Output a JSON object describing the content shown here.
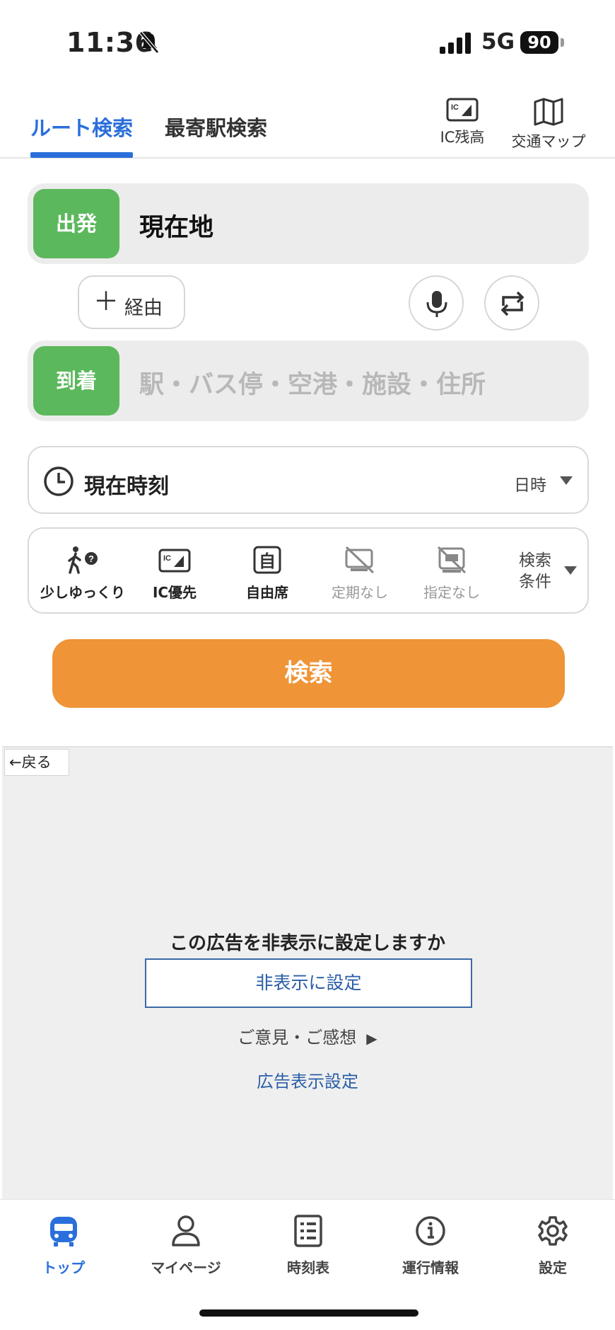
{
  "status_bar": {
    "time": "11:36",
    "network": "5G",
    "battery": "90"
  },
  "header": {
    "tabs": [
      {
        "label": "ルート検索",
        "active": true
      },
      {
        "label": "最寄駅検索",
        "active": false
      }
    ],
    "ic_balance_label": "IC残高",
    "transit_map_label": "交通マップ",
    "accent_color": "#2a6fdb"
  },
  "route": {
    "departure_tag": "出発",
    "departure_value": "現在地",
    "via_label": "経由",
    "arrival_tag": "到着",
    "arrival_placeholder": "駅・バス停・空港・施設・住所",
    "tag_color": "#5cb85c"
  },
  "time": {
    "label": "現在時刻",
    "selector_label": "日時"
  },
  "conditions": {
    "items": [
      {
        "label": "少しゆっくり",
        "icon": "walk-slow-icon",
        "enabled": true
      },
      {
        "label": "IC優先",
        "icon": "ic-card-icon",
        "enabled": true
      },
      {
        "label": "自由席",
        "icon": "free-seat-icon",
        "enabled": true
      },
      {
        "label": "定期なし",
        "icon": "no-commuter-pass-icon",
        "enabled": false
      },
      {
        "label": "指定なし",
        "icon": "no-reserved-seat-icon",
        "enabled": false
      }
    ],
    "more_label_line1": "検索",
    "more_label_line2": "条件"
  },
  "search_button": {
    "label": "検索",
    "color": "#ef9437"
  },
  "ad": {
    "back_label": "戻る",
    "question": "この広告を非表示に設定しますか",
    "hide_button": "非表示に設定",
    "feedback_link": "ご意見・ご感想",
    "settings_link": "広告表示設定"
  },
  "bottom_nav": {
    "items": [
      {
        "label": "トップ",
        "icon": "train-icon",
        "active": true
      },
      {
        "label": "マイページ",
        "icon": "person-icon",
        "active": false
      },
      {
        "label": "時刻表",
        "icon": "timetable-icon",
        "active": false
      },
      {
        "label": "運行情報",
        "icon": "info-icon",
        "active": false
      },
      {
        "label": "設定",
        "icon": "gear-icon",
        "active": false
      }
    ]
  }
}
